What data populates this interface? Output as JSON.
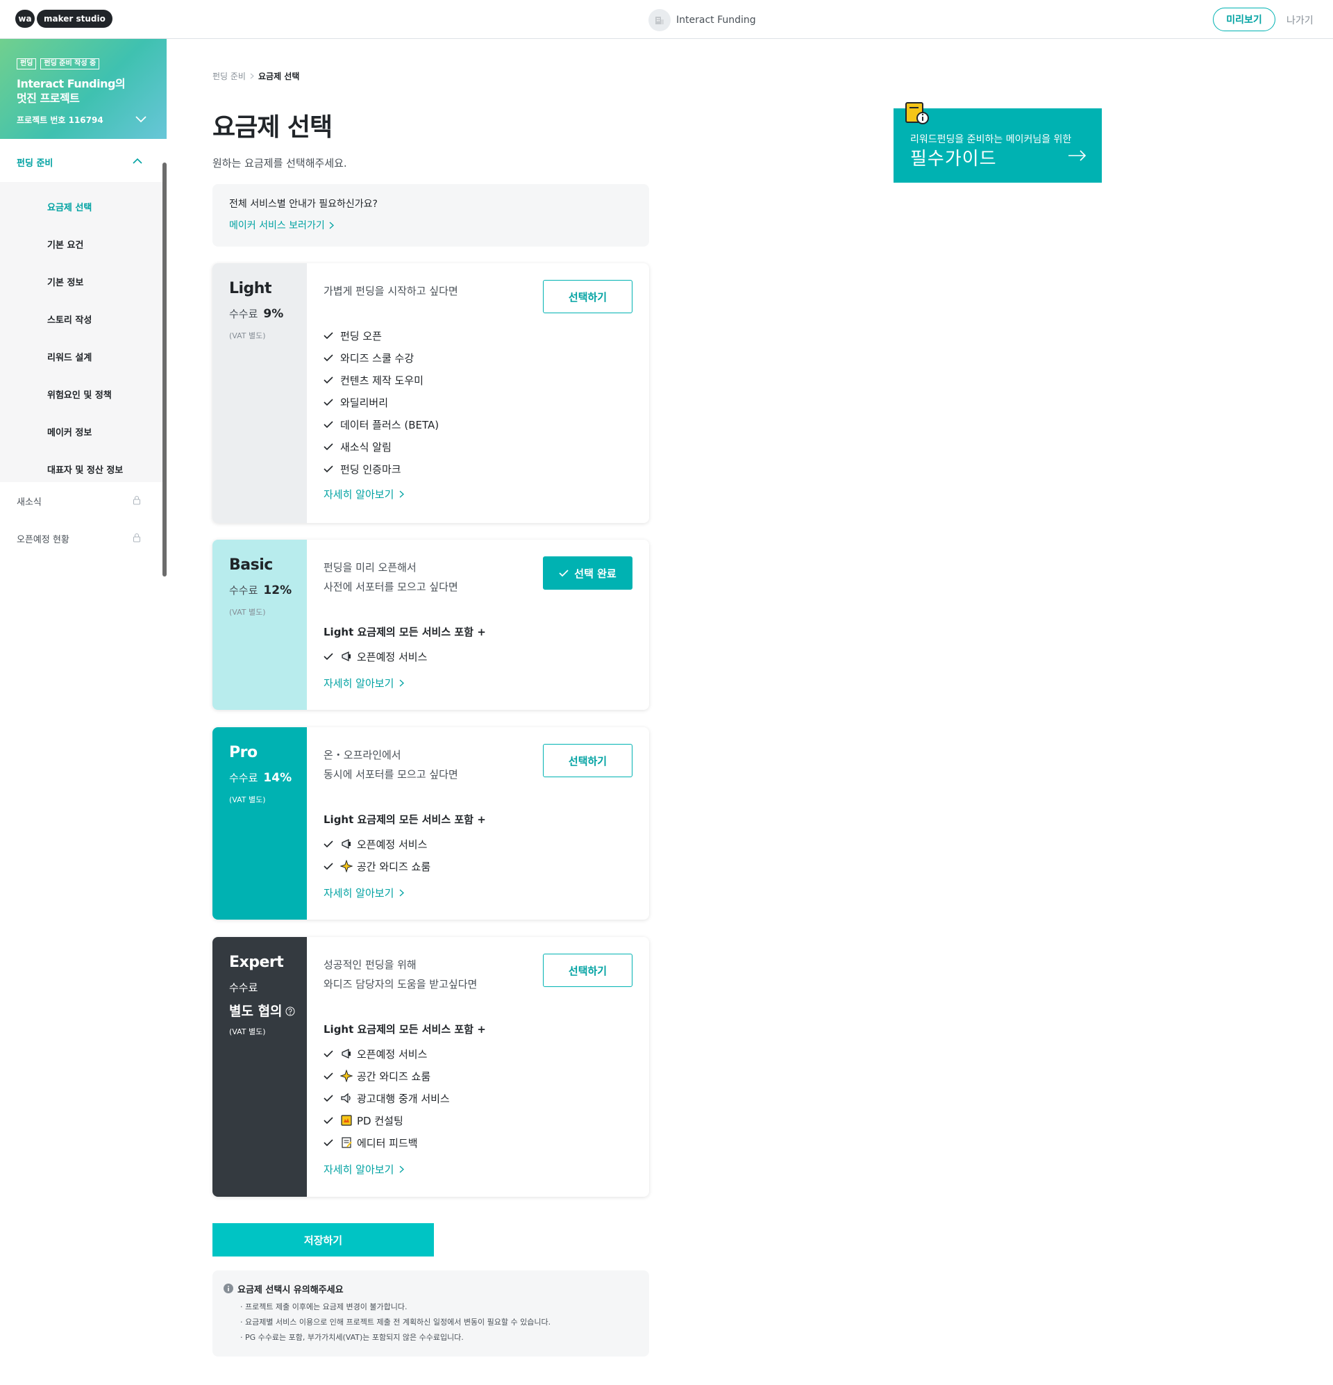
{
  "header": {
    "logo_wa": "wa",
    "logo_text": "maker studio",
    "project_name": "Interact Funding",
    "preview_label": "미리보기",
    "exit_label": "나가기"
  },
  "sidebar": {
    "badges": [
      "펀딩",
      "펀딩 준비 작성 중"
    ],
    "project_title": "Interact Funding의 멋진 프로젝트",
    "project_number": "프로젝트 번호 116794",
    "section_label": "펀딩 준비",
    "items": [
      "요금제 선택",
      "기본 요건",
      "기본 정보",
      "스토리 작성",
      "리워드 설계",
      "위험요인 및 정책",
      "메이커 정보",
      "대표자 및 정산 정보"
    ],
    "locked_items": [
      "새소식",
      "오픈예정 현황"
    ]
  },
  "breadcrumb": {
    "parent": "펀딩 준비",
    "current": "요금제 선택"
  },
  "page": {
    "title": "요금제 선택",
    "subtitle": "원하는 요금제를 선택해주세요."
  },
  "info_box": {
    "question": "전체 서비스별 안내가 필요하신가요?",
    "link": "메이커 서비스 보러가기"
  },
  "guide": {
    "subtitle": "리워드펀딩을 준비하는 메이커님을 위한",
    "title": "필수가이드"
  },
  "common": {
    "fee_label": "수수료",
    "vat": "(VAT 별도)",
    "select_label": "선택하기",
    "selected_label": "선택 완료",
    "more_label": "자세히 알아보기",
    "includes_label": "Light 요금제의 모든 서비스 포함 +"
  },
  "plans": {
    "light": {
      "name": "Light",
      "fee": "9%",
      "desc": [
        "가볍게 펀딩을 시작하고 싶다면"
      ],
      "features": [
        "펀딩 오픈",
        "와디즈 스쿨 수강",
        "컨텐츠 제작 도우미",
        "와딜리버리",
        "데이터 플러스 (BETA)",
        "새소식 알림",
        "펀딩 인증마크"
      ]
    },
    "basic": {
      "name": "Basic",
      "fee": "12%",
      "desc": [
        "펀딩을 미리 오픈해서",
        "사전에 서포터를 모으고 싶다면"
      ],
      "features": [
        "오픈예정 서비스"
      ]
    },
    "pro": {
      "name": "Pro",
      "fee": "14%",
      "desc": [
        "온・오프라인에서",
        "동시에 서포터를 모으고 싶다면"
      ],
      "features": [
        "오픈예정 서비스",
        "공간 와디즈 쇼룸"
      ]
    },
    "expert": {
      "name": "Expert",
      "fee": "별도 협의",
      "desc": [
        "성공적인 펀딩을 위해",
        "와디즈 담당자의 도움을 받고싶다면"
      ],
      "features": [
        "오픈예정 서비스",
        "공간 와디즈 쇼룸",
        "광고대행 중개 서비스",
        "PD 컨설팅",
        "에디터 피드백"
      ]
    }
  },
  "save_label": "저장하기",
  "notice": {
    "title": "요금제 선택시 유의해주세요",
    "lines": [
      "· 프로젝트 제출 이후에는 요금제 변경이 불가합니다.",
      "· 요금제별 서비스 이용으로 인해 프로젝트 제출 전 계획하신 일정에서 변동이 필요할 수 있습니다.",
      "· PG 수수료는 포함, 부가가치세(VAT)는 포함되지 않은 수수료입니다."
    ]
  },
  "colors": {
    "accent": "#00b2b2",
    "basic_bg": "#b8eced",
    "light_bg": "#eceef0",
    "pro_bg": "#00b2b2",
    "expert_bg": "#343a40"
  }
}
